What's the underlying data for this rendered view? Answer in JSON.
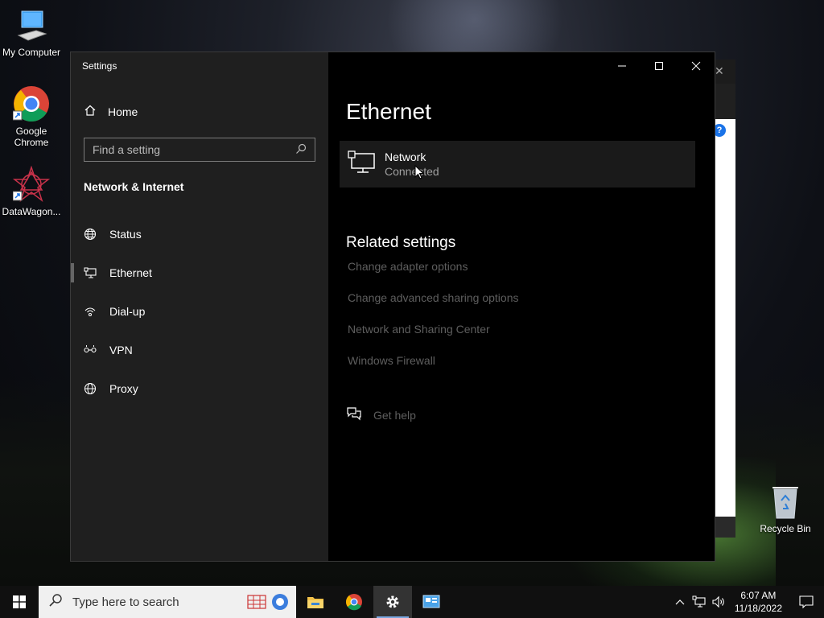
{
  "desktop": {
    "icons": [
      {
        "label": "My Computer"
      },
      {
        "label": "Google Chrome"
      },
      {
        "label": "DataWagon..."
      }
    ],
    "recycle_bin": "Recycle Bin"
  },
  "settings": {
    "window_title": "Settings",
    "home_label": "Home",
    "search_placeholder": "Find a setting",
    "section_title": "Network & Internet",
    "nav": [
      {
        "label": "Status",
        "icon": "globe-status-icon"
      },
      {
        "label": "Ethernet",
        "icon": "ethernet-icon",
        "active": true
      },
      {
        "label": "Dial-up",
        "icon": "dial-up-icon"
      },
      {
        "label": "VPN",
        "icon": "vpn-icon"
      },
      {
        "label": "Proxy",
        "icon": "globe-icon"
      }
    ],
    "page_title": "Ethernet",
    "network": {
      "name": "Network",
      "status": "Connected"
    },
    "related_title": "Related settings",
    "related_links": [
      "Change adapter options",
      "Change advanced sharing options",
      "Network and Sharing Center",
      "Windows Firewall"
    ],
    "get_help": "Get help"
  },
  "taskbar": {
    "search_placeholder": "Type here to search",
    "time": "6:07 AM",
    "date": "11/18/2022"
  },
  "colors": {
    "left_pane": "#1f1f1f",
    "right_pane": "#000000",
    "muted_link": "#5e5e5e",
    "accent": "#7aa7e0"
  }
}
